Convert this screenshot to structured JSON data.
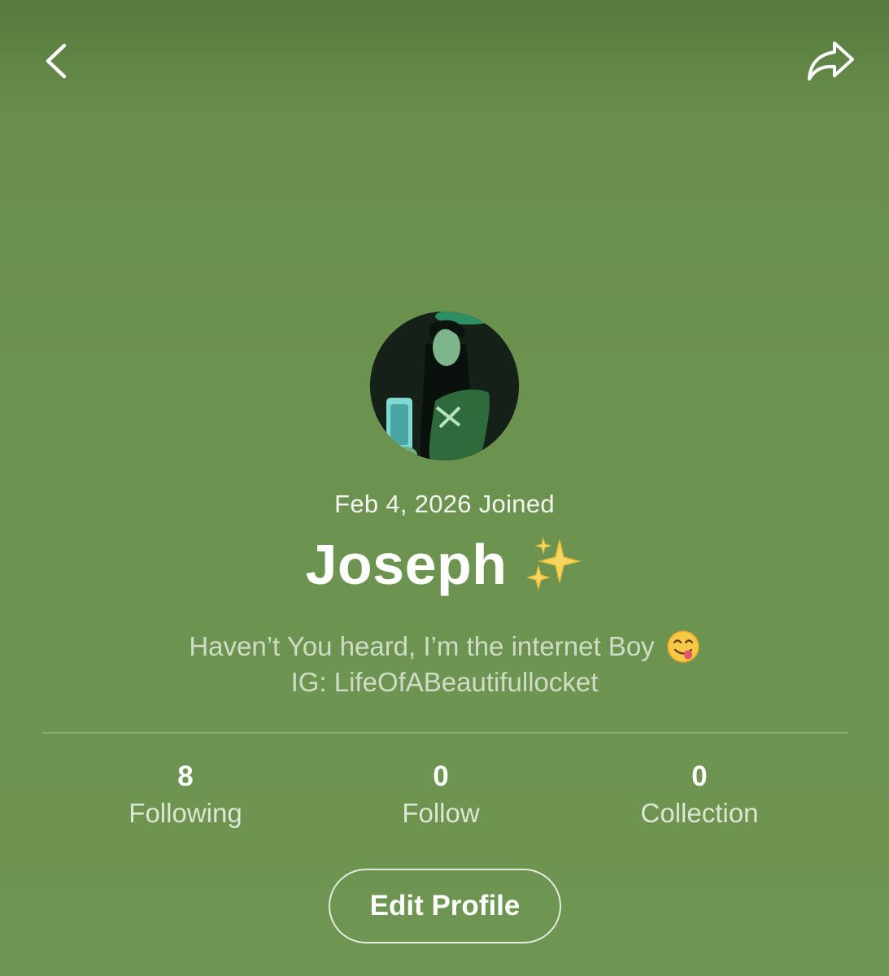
{
  "header": {
    "back_icon": "chevron-left-icon",
    "share_icon": "share-arrow-icon"
  },
  "profile": {
    "avatar_icon": "profile-photo",
    "joined": "Feb 4, 2026 Joined",
    "name": "Joseph",
    "name_emoji": "sparkles-icon",
    "bio_line1": "Haven’t You heard, I’m the internet Boy",
    "bio_emoji": "face-savoring-food-icon",
    "bio_line2": "IG: LifeOfABeautifullocket"
  },
  "stats": [
    {
      "count": "8",
      "label": "Following"
    },
    {
      "count": "0",
      "label": "Follow"
    },
    {
      "count": "0",
      "label": "Collection"
    }
  ],
  "actions": {
    "edit_profile": "Edit Profile"
  },
  "colors": {
    "background": "#6c924f",
    "bio_text": "#cfdcc6",
    "accent_yellow": "#f5d56a"
  }
}
